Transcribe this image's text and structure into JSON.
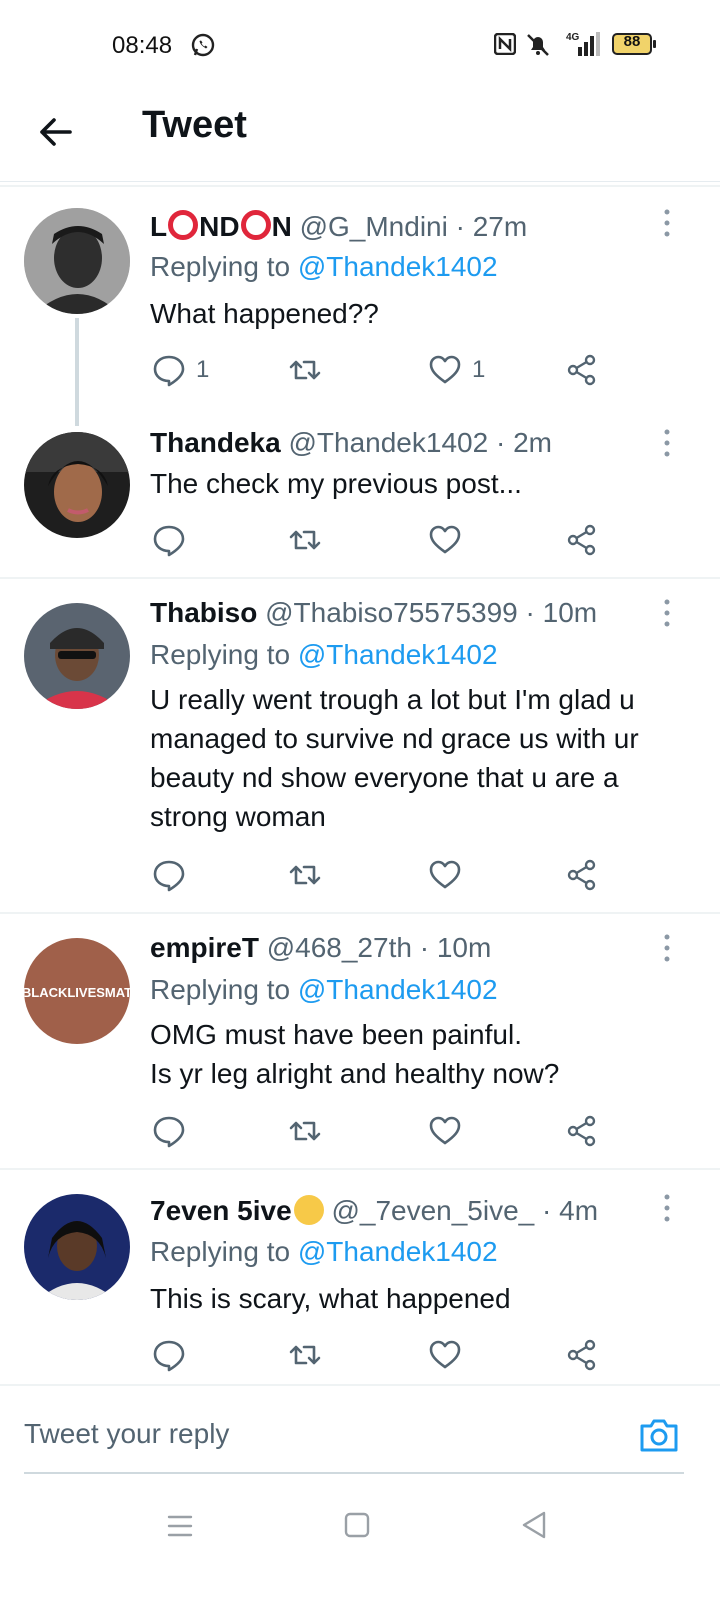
{
  "status_bar": {
    "time": "08:48",
    "network": "4G",
    "battery": "88"
  },
  "header": {
    "title": "Tweet"
  },
  "tweets": [
    {
      "name_parts": [
        "L",
        "ND",
        "N"
      ],
      "handle": "@G_Mndini",
      "time": "27m",
      "replying_prefix": "Replying to",
      "replying_to": "@Thandek1402",
      "text": "What happened??",
      "reply_count": "1",
      "retweet_count": "",
      "like_count": "1"
    },
    {
      "name": "Thandeka",
      "handle": "@Thandek1402",
      "time": "2m",
      "text": "The check my previous post..."
    },
    {
      "name": "Thabiso",
      "handle": "@Thabiso75575399",
      "time": "10m",
      "replying_prefix": "Replying to",
      "replying_to": "@Thandek1402",
      "text": "U really went trough a lot but I'm glad u\nmanaged to survive nd grace us with ur\nbeauty nd show everyone that u are a\nstrong woman"
    },
    {
      "name": "empireT",
      "handle": "@468_27th",
      "time": "10m",
      "avatar_text": "BLACKLIVESMAT",
      "replying_prefix": "Replying to",
      "replying_to": "@Thandek1402",
      "text": "OMG must have been painful.\nIs yr leg alright and healthy now?"
    },
    {
      "name": "7even 5ive",
      "handle": "@_7even_5ive_",
      "time": "4m",
      "replying_prefix": "Replying to",
      "replying_to": "@Thandek1402",
      "text": "This is scary, what happened"
    }
  ],
  "composer": {
    "placeholder": "Tweet your reply"
  },
  "colors": {
    "link": "#1d9bf0",
    "secondary_text": "#536471",
    "ring_red": "#e0263b"
  }
}
